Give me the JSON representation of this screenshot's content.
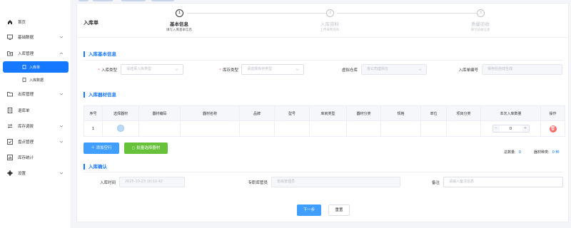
{
  "sidebar": {
    "items": [
      {
        "label": "首页",
        "icon": "home-icon"
      },
      {
        "label": "基础数据",
        "icon": "monitor-icon"
      },
      {
        "label": "入库管理",
        "icon": "folder-in-icon"
      },
      {
        "label": "入库单",
        "icon": "document-icon"
      },
      {
        "label": "入库数据",
        "icon": "document-icon"
      },
      {
        "label": "出库管理",
        "icon": "folder-out-icon"
      },
      {
        "label": "退库单",
        "icon": "return-icon"
      },
      {
        "label": "库存调拨",
        "icon": "transfer-icon"
      },
      {
        "label": "盘点管理",
        "icon": "inventory-icon"
      },
      {
        "label": "库存统计",
        "icon": "stats-icon"
      },
      {
        "label": "设置",
        "icon": "gear-icon"
      }
    ]
  },
  "header": {
    "title": "入库单",
    "steps": [
      {
        "num": "1",
        "title": "基本信息",
        "desc": "填写入库基本信息"
      },
      {
        "num": "2",
        "title": "入库资料",
        "desc": "上传采购资料"
      },
      {
        "num": "3",
        "title": "质量验收",
        "desc": "填写验收信息"
      }
    ]
  },
  "basic": {
    "section_title": "入库基本信息",
    "inbound_type_label": "入库类型",
    "inbound_type_placeholder": "请选择入库类型",
    "stock_type_label": "库存类型",
    "stock_type_placeholder": "请选择库存类型",
    "warehouse_label": "虚拟仓库",
    "warehouse_value": "省公司虚拟仓",
    "order_no_label": "入库单编号",
    "order_no_value": "保存后自动生成"
  },
  "materials": {
    "section_title": "入库器材信息",
    "columns": [
      "序号",
      "选择器材",
      "器材编码",
      "器材名称",
      "品牌",
      "型号",
      "库房类型",
      "器材分类",
      "规格",
      "单位",
      "项目分类",
      "本次入库数量",
      "操作"
    ],
    "rows": [
      {
        "index": "1",
        "qty": "0"
      }
    ],
    "add_row_label": "添加空行",
    "batch_select_label": "批量选择器材",
    "total_qty_label": "总数量:",
    "total_qty_value": "0",
    "total_kinds_label": "器材种类:",
    "total_kinds_value": "0 种"
  },
  "confirm": {
    "section_title": "入库确认",
    "time_label": "入库时间",
    "time_value": "2025-10-23 10:12:42",
    "keeper_label": "专职库管员",
    "keeper_value": "省级管理员",
    "remark_label": "备注",
    "remark_placeholder": "请输入备注信息"
  },
  "actions": {
    "next_label": "下一步",
    "reset_label": "重置"
  },
  "colors": {
    "accent": "#1677ff",
    "danger": "#f56c6c",
    "success": "#67c23a"
  }
}
